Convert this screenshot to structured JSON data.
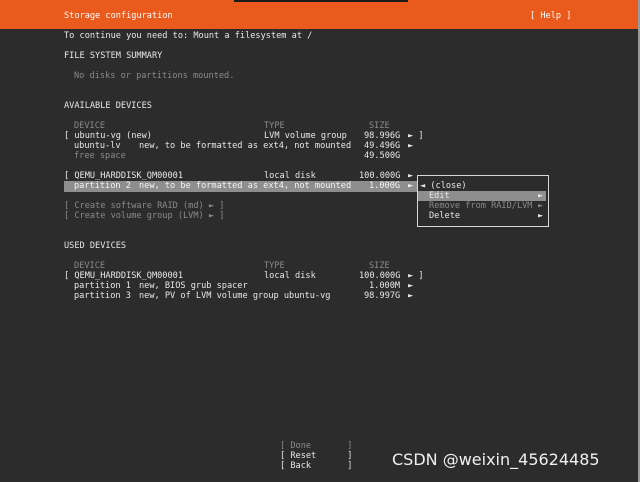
{
  "header": {
    "title": "Storage configuration",
    "help": "[ Help ]"
  },
  "instruction": "To continue you need to: Mount a filesystem at /",
  "fs_summary": {
    "heading": "FILE SYSTEM SUMMARY",
    "empty": "No disks or partitions mounted."
  },
  "available": {
    "heading": "AVAILABLE DEVICES",
    "col_device": "DEVICE",
    "col_type": "TYPE",
    "col_size": "SIZE",
    "vg": {
      "name": "[ ubuntu-vg (new)",
      "type": "LVM volume group",
      "size": "98.996G",
      "arrow": "► ]"
    },
    "lv": {
      "name": "ubuntu-lv",
      "desc": "new, to be formatted as ext4, not mounted",
      "size": "49.496G",
      "arrow": "►"
    },
    "free": {
      "name": "free space",
      "size": "49.500G"
    },
    "disk": {
      "name": "[ QEMU_HARDDISK_QM00001",
      "type": "local disk",
      "size": "100.000G",
      "arrow": "►"
    },
    "part2": {
      "name": "partition 2",
      "desc": "new, to be formatted as ext4, not mounted",
      "size": "1.000G",
      "arrow": "►"
    },
    "create_raid": "[ Create software RAID (md) ► ]",
    "create_lvm": "[ Create volume group (LVM) ► ]"
  },
  "menu": {
    "close": "◄ (close)",
    "edit": "Edit",
    "edit_arrow": "►",
    "remove": "Remove from RAID/LVM",
    "remove_arrow": "►",
    "delete": "Delete",
    "delete_arrow": "►"
  },
  "used": {
    "heading": "USED DEVICES",
    "col_device": "DEVICE",
    "col_type": "TYPE",
    "col_size": "SIZE",
    "disk": {
      "name": "[ QEMU_HARDDISK_QM00001",
      "type": "local disk",
      "size": "100.000G",
      "arrow": "► ]"
    },
    "part1": {
      "name": "partition 1",
      "desc": "new, BIOS grub spacer",
      "size": "1.000M",
      "arrow": "►"
    },
    "part3": {
      "name": "partition 3",
      "desc": "new, PV of LVM volume group ubuntu-vg",
      "size": "98.997G",
      "arrow": "►"
    }
  },
  "buttons": {
    "done": "[ Done       ]",
    "reset": "[ Reset      ]",
    "back": "[ Back       ]"
  },
  "watermark": "CSDN @weixin_45624485",
  "colors": {
    "accent": "#ea5a1c",
    "background": "#2c2c2c",
    "highlight": "#8e8e8e"
  }
}
